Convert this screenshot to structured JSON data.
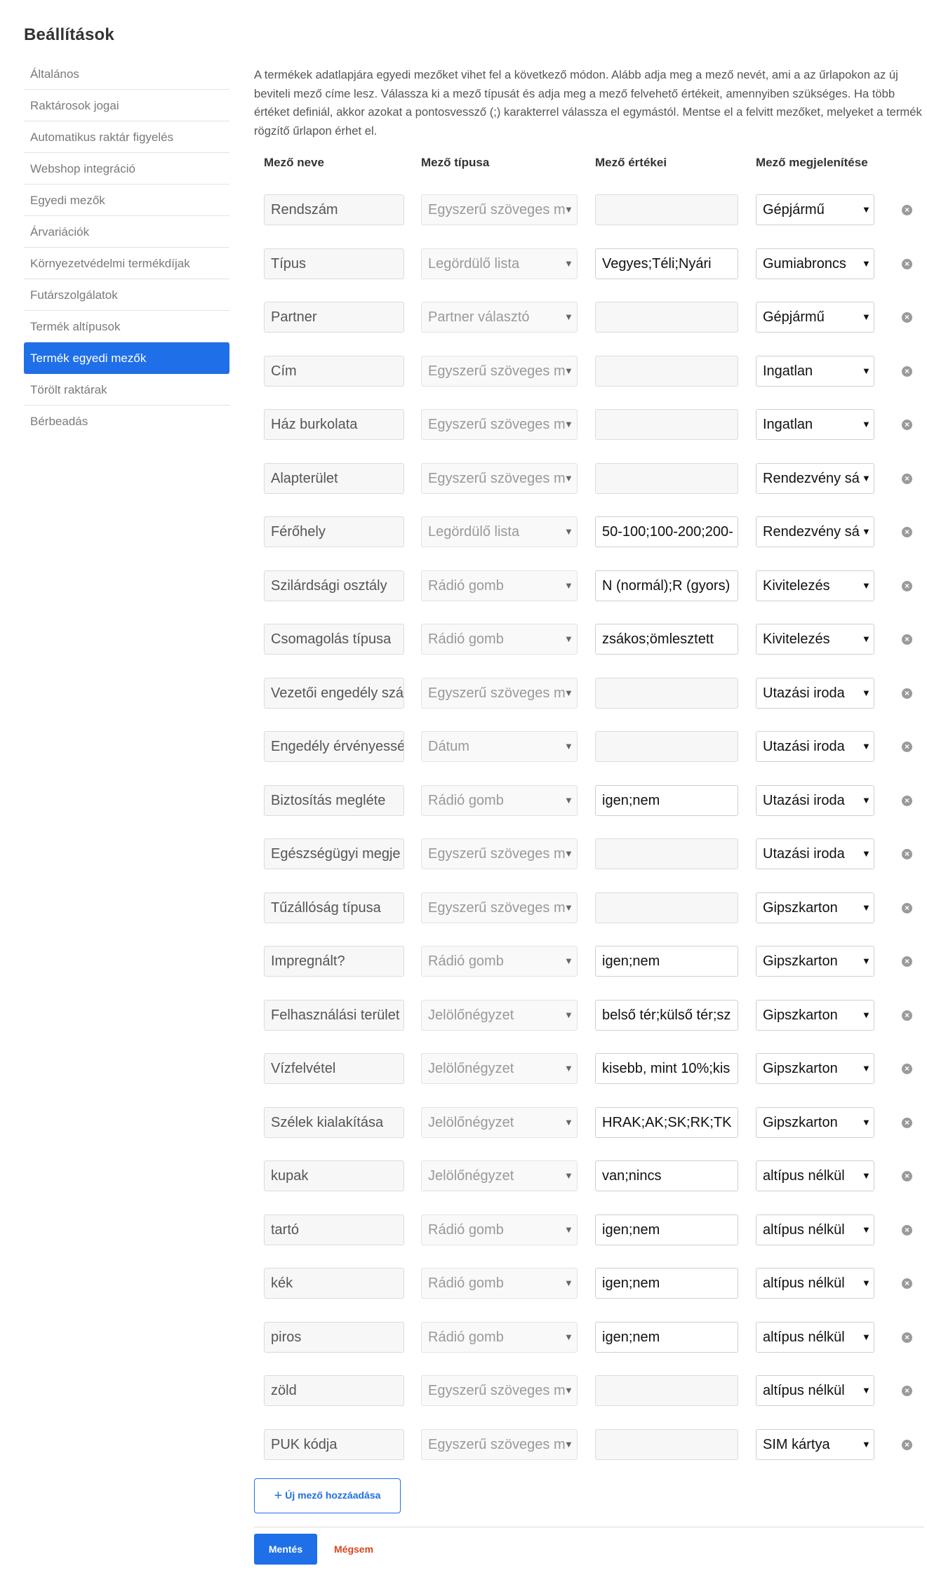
{
  "page": {
    "title": "Beállítások"
  },
  "sidebar": {
    "items": [
      {
        "label": "Általános"
      },
      {
        "label": "Raktárosok jogai"
      },
      {
        "label": "Automatikus raktár figyelés"
      },
      {
        "label": "Webshop integráció"
      },
      {
        "label": "Egyedi mezők"
      },
      {
        "label": "Árvariációk"
      },
      {
        "label": "Környezetvédelmi termékdíjak"
      },
      {
        "label": "Futárszolgálatok"
      },
      {
        "label": "Termék altípusok"
      },
      {
        "label": "Termék egyedi mezők",
        "active": true
      },
      {
        "label": "Törölt raktárak"
      },
      {
        "label": "Bérbeadás"
      }
    ]
  },
  "main": {
    "description": "A termékek adatlapjára egyedi mezőket vihet fel a következő módon. Alább adja meg a mező nevét, ami a az űrlapokon az új beviteli mező címe lesz. Válassza ki a mező típusát és adja meg a mező felvehető értékeit, amennyiben szükséges. Ha több értéket definiál, akkor azokat a pontosvessző (;) karakterrel válassza el egymástól. Mentse el a felvitt mezőket, melyeket a termék rögzítő űrlapon érhet el.",
    "columns": {
      "name": "Mező neve",
      "type": "Mező típusa",
      "values": "Mező értékei",
      "display": "Mező megjelenítése"
    },
    "fields": [
      {
        "name": "Rendszám",
        "type": "Egyszerű szöveges m",
        "values": "",
        "display": "Gépjármű"
      },
      {
        "name": "Típus",
        "type": "Legördülő lista",
        "values": "Vegyes;Téli;Nyári",
        "display": "Gumiabroncs"
      },
      {
        "name": "Partner",
        "type": "Partner választó",
        "values": "",
        "display": "Gépjármű"
      },
      {
        "name": "Cím",
        "type": "Egyszerű szöveges m",
        "values": "",
        "display": "Ingatlan"
      },
      {
        "name": "Ház burkolata",
        "type": "Egyszerű szöveges m",
        "values": "",
        "display": "Ingatlan"
      },
      {
        "name": "Alapterület",
        "type": "Egyszerű szöveges m",
        "values": "",
        "display": "Rendezvény sá"
      },
      {
        "name": "Férőhely",
        "type": "Legördülő lista",
        "values": "50-100;100-200;200-",
        "display": "Rendezvény sá"
      },
      {
        "name": "Szilárdsági osztály",
        "type": "Rádió gomb",
        "values": "N (normál);R (gyors)",
        "display": "Kivitelezés"
      },
      {
        "name": "Csomagolás típusa",
        "type": "Rádió gomb",
        "values": "zsákos;ömlesztett",
        "display": "Kivitelezés"
      },
      {
        "name": "Vezetői engedély szá",
        "type": "Egyszerű szöveges m",
        "values": "",
        "display": "Utazási iroda"
      },
      {
        "name": "Engedély érvényessé",
        "type": "Dátum",
        "values": "",
        "display": "Utazási iroda"
      },
      {
        "name": "Biztosítás megléte",
        "type": "Rádió gomb",
        "values": "igen;nem",
        "display": "Utazási iroda"
      },
      {
        "name": "Egészségügyi megje",
        "type": "Egyszerű szöveges m",
        "values": "",
        "display": "Utazási iroda"
      },
      {
        "name": "Tűzállóság típusa",
        "type": "Egyszerű szöveges m",
        "values": "",
        "display": "Gipszkarton"
      },
      {
        "name": "Impregnált?",
        "type": "Rádió gomb",
        "values": "igen;nem",
        "display": "Gipszkarton"
      },
      {
        "name": "Felhasználási terület",
        "type": "Jelölőnégyzet",
        "values": "belső tér;külső tér;sz",
        "display": "Gipszkarton"
      },
      {
        "name": "Vízfelvétel",
        "type": "Jelölőnégyzet",
        "values": "kisebb, mint 10%;kis",
        "display": "Gipszkarton"
      },
      {
        "name": "Szélek kialakítása",
        "type": "Jelölőnégyzet",
        "values": "HRAK;AK;SK;RK;TK",
        "display": "Gipszkarton"
      },
      {
        "name": "kupak",
        "type": "Jelölőnégyzet",
        "values": "van;nincs",
        "display": "altípus nélkül"
      },
      {
        "name": "tartó",
        "type": "Rádió gomb",
        "values": "igen;nem",
        "display": "altípus nélkül"
      },
      {
        "name": "kék",
        "type": "Rádió gomb",
        "values": "igen;nem",
        "display": "altípus nélkül"
      },
      {
        "name": "piros",
        "type": "Rádió gomb",
        "values": "igen;nem",
        "display": "altípus nélkül"
      },
      {
        "name": "zöld",
        "type": "Egyszerű szöveges m",
        "values": "",
        "display": "altípus nélkül"
      },
      {
        "name": "PUK kódja",
        "type": "Egyszerű szöveges m",
        "values": "",
        "display": "SIM kártya"
      }
    ],
    "add_button": "Új mező hozzáadása",
    "save_button": "Mentés",
    "cancel_link": "Mégsem"
  },
  "icons": {
    "dropdown": "triangle-down-icon",
    "remove": "remove-circle-icon",
    "add": "plus-icon"
  },
  "colors": {
    "accent": "#1f6fe8",
    "cancel": "#d8461e"
  }
}
